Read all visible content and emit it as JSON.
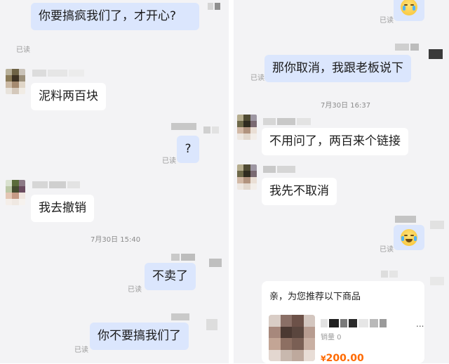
{
  "left_chat": {
    "messages": [
      {
        "id": "m1",
        "side": "me",
        "text": "你要搞疯我们了，才开心?",
        "read": "已读"
      },
      {
        "id": "m2",
        "side": "them",
        "text": "泥料两百块"
      },
      {
        "id": "m3",
        "side": "me",
        "text": "?",
        "read": "已读"
      },
      {
        "id": "m4",
        "side": "them",
        "text": "我去撤销"
      },
      {
        "id": "m5",
        "side": "me",
        "text": "不卖了",
        "read": "已读"
      },
      {
        "id": "m6",
        "side": "me",
        "text": "你不要搞我们了",
        "read": "已读"
      }
    ],
    "timestamp": "7月30日 15:40"
  },
  "right_chat": {
    "messages": [
      {
        "id": "r1",
        "side": "me",
        "text": "那你取消，我跟老板说下",
        "read": "已读"
      },
      {
        "id": "r2",
        "side": "them",
        "text": "不用问了，两百来个链接"
      },
      {
        "id": "r3",
        "side": "them",
        "text": "我先不取消"
      },
      {
        "id": "r4",
        "side": "me",
        "emoji": "crying-laughing-emoji",
        "read": "已读"
      }
    ],
    "read_top": "已读",
    "timestamp": "7月30日 16:37",
    "product_card": {
      "title": "亲，为您推荐以下商品",
      "name_ellipsis": "...",
      "sales": "销量 0",
      "currency": "¥",
      "price": "200.00"
    }
  },
  "colors": {
    "bubble_me": "#dbe6fd",
    "bubble_them": "#ffffff",
    "background": "#f3f3f5",
    "price": "#ff6a00"
  }
}
